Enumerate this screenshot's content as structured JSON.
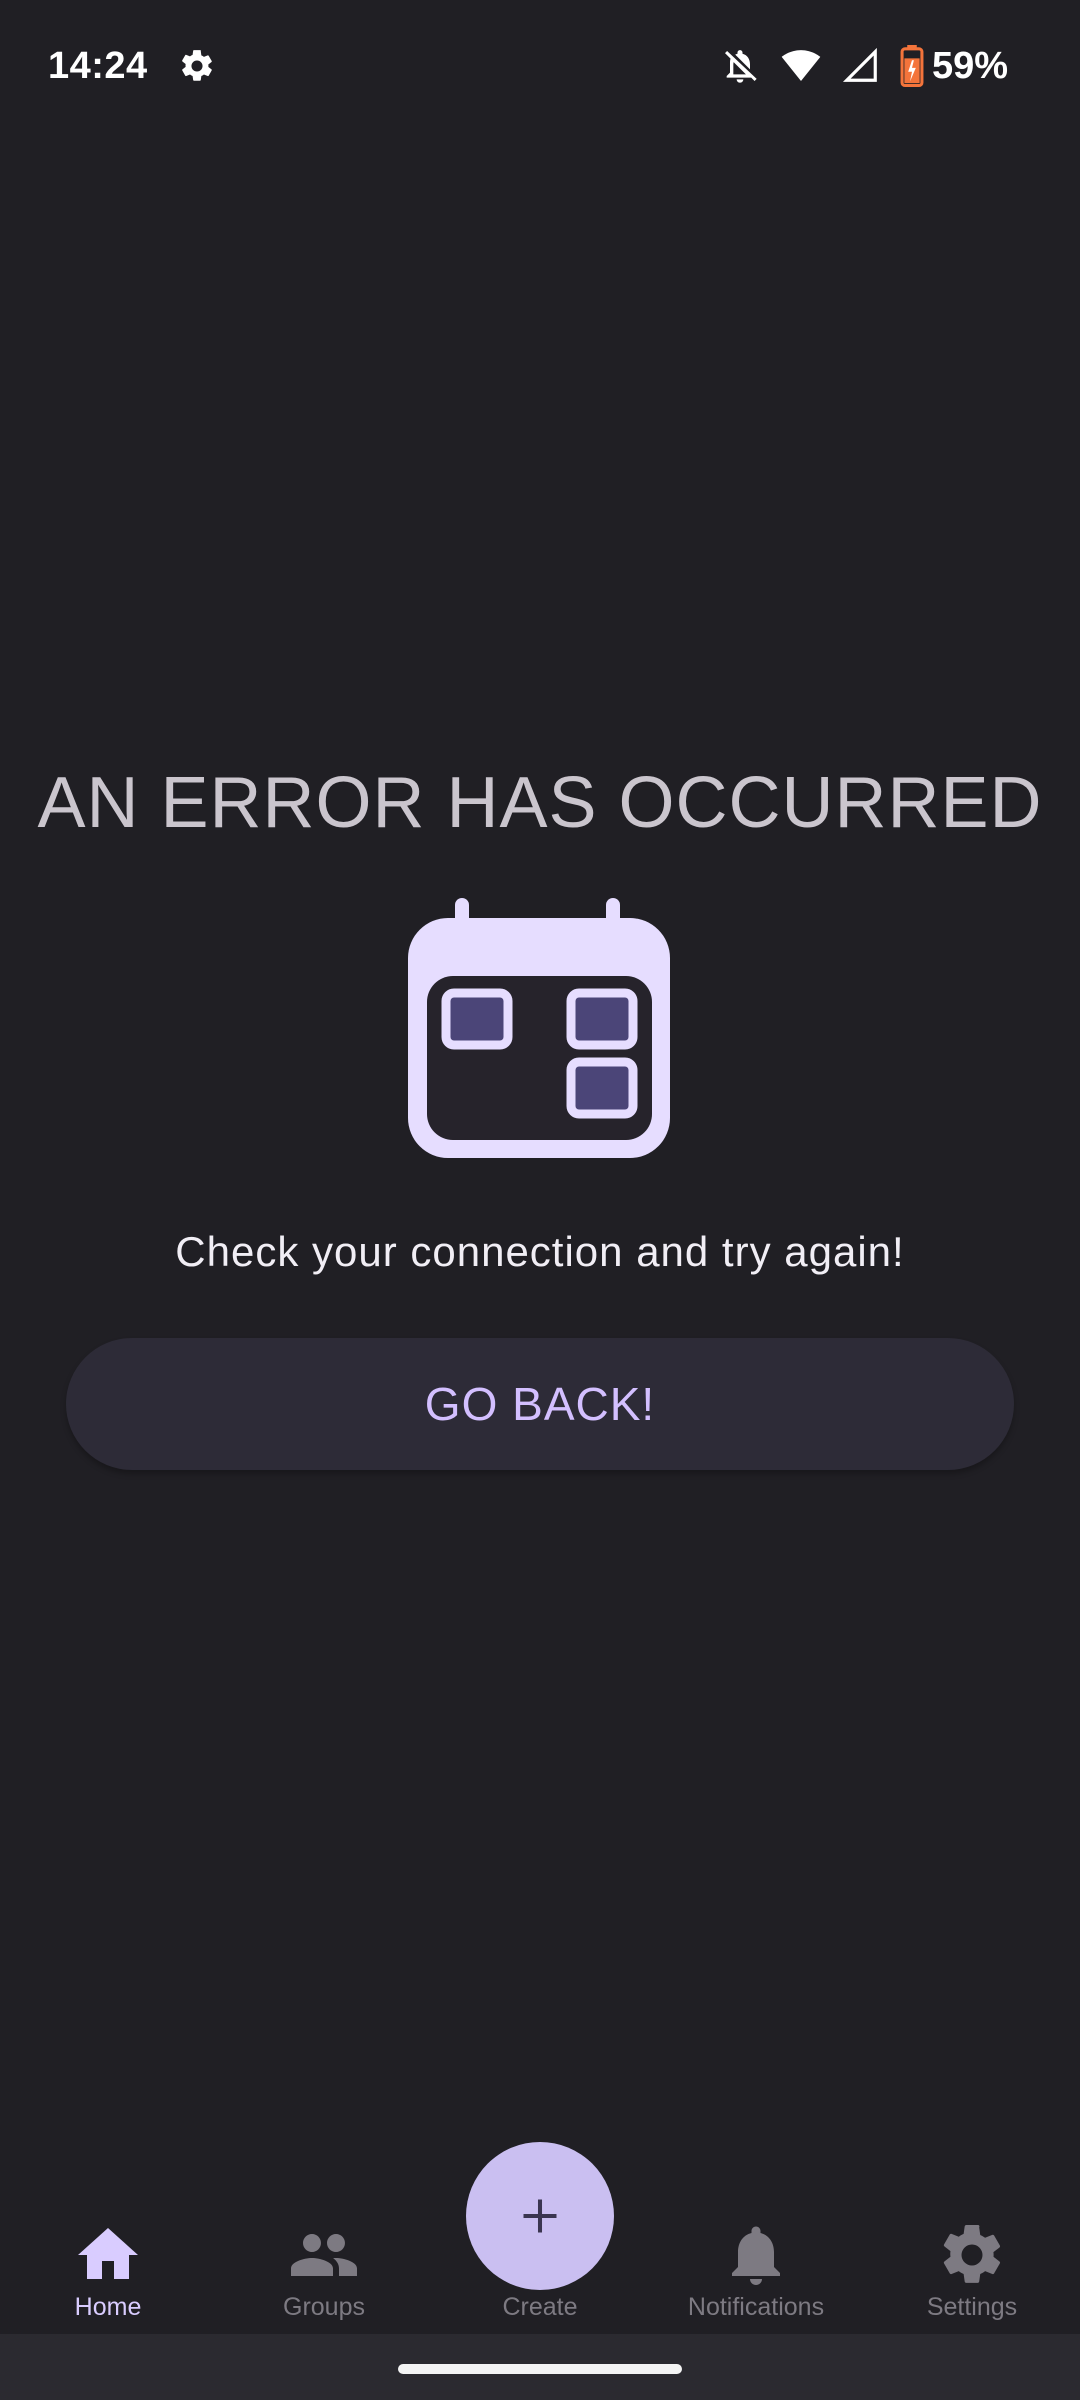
{
  "status_bar": {
    "time": "14:24",
    "battery": "59%",
    "icons": [
      "settings-icon",
      "notifications-off-icon",
      "wifi-icon",
      "signal-icon",
      "battery-icon"
    ]
  },
  "error": {
    "title": "AN ERROR HAS OCCURRED",
    "message": "Check your connection and try again!",
    "illustration": "calendar-icon"
  },
  "go_back": {
    "label": "GO BACK!"
  },
  "bottom_nav": {
    "items": [
      {
        "label": "Home",
        "icon": "home-icon",
        "active": true
      },
      {
        "label": "Groups",
        "icon": "groups-icon",
        "active": false
      },
      {
        "label": "Create",
        "icon": "plus-icon",
        "active": false
      },
      {
        "label": "Notifications",
        "icon": "bell-icon",
        "active": false
      },
      {
        "label": "Settings",
        "icon": "gear-icon",
        "active": false
      }
    ]
  },
  "colors": {
    "background": "#201f24",
    "accent": "#cabff1",
    "active_label": "#d9ccff",
    "button_bg": "#2d2b37",
    "button_text": "#d3bfff",
    "calendar": "#e6ddff",
    "calendar_cells": "#4b4578",
    "battery_warning": "#f4743b"
  }
}
